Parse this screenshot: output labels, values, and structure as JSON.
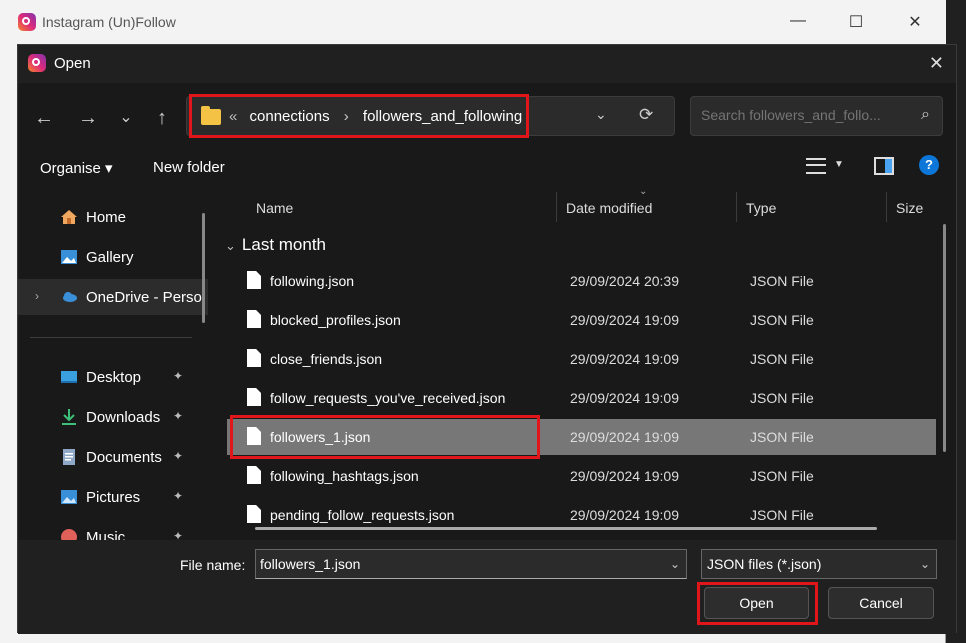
{
  "app": {
    "title": "Instagram (Un)Follow",
    "controls": [
      "—",
      "☐",
      "✕"
    ]
  },
  "dialog": {
    "title": "Open",
    "close": "✕",
    "nav": {
      "back": "←",
      "forward": "→",
      "recent": "⌄",
      "up": "↑"
    },
    "address": {
      "prefix": "«",
      "segments": [
        "connections",
        "followers_and_following"
      ],
      "separator": "›",
      "dropdown": "⌄",
      "refresh": "⟳"
    },
    "search": {
      "placeholder": "Search followers_and_follo..."
    },
    "toolbar": {
      "organise": "Organise ▾",
      "new_folder": "New folder",
      "help": "?"
    },
    "sidebar": {
      "items": [
        {
          "label": "Home",
          "icon": "home-icon"
        },
        {
          "label": "Gallery",
          "icon": "gallery-icon"
        },
        {
          "label": "OneDrive - Perso",
          "icon": "cloud-icon"
        },
        {
          "label": "Desktop",
          "icon": "desktop-icon",
          "pinned": true
        },
        {
          "label": "Downloads",
          "icon": "download-icon",
          "pinned": true
        },
        {
          "label": "Documents",
          "icon": "documents-icon",
          "pinned": true
        },
        {
          "label": "Pictures",
          "icon": "pictures-icon",
          "pinned": true
        },
        {
          "label": "Music",
          "icon": "music-icon",
          "pinned": true
        }
      ],
      "expand": "›",
      "pin": "📌"
    },
    "columns": {
      "name": "Name",
      "date": "Date modified",
      "type": "Type",
      "size": "Size"
    },
    "group": {
      "label": "Last month",
      "chevron": "⌄"
    },
    "files": [
      {
        "name": "following.json",
        "date": "29/09/2024 20:39",
        "type": "JSON File"
      },
      {
        "name": "blocked_profiles.json",
        "date": "29/09/2024 19:09",
        "type": "JSON File"
      },
      {
        "name": "close_friends.json",
        "date": "29/09/2024 19:09",
        "type": "JSON File"
      },
      {
        "name": "follow_requests_you've_received.json",
        "date": "29/09/2024 19:09",
        "type": "JSON File"
      },
      {
        "name": "followers_1.json",
        "date": "29/09/2024 19:09",
        "type": "JSON File",
        "selected": true
      },
      {
        "name": "following_hashtags.json",
        "date": "29/09/2024 19:09",
        "type": "JSON File"
      },
      {
        "name": "pending_follow_requests.json",
        "date": "29/09/2024 19:09",
        "type": "JSON File"
      }
    ],
    "footer": {
      "file_name_label": "File name:",
      "file_name_value": "followers_1.json",
      "file_type": "JSON files (*.json)",
      "caret": "⌄",
      "open_label": "Open",
      "cancel_label": "Cancel"
    },
    "colors": {
      "highlight": "#e0161b",
      "selected_row": "#777777",
      "folder": "#f4c244"
    }
  }
}
